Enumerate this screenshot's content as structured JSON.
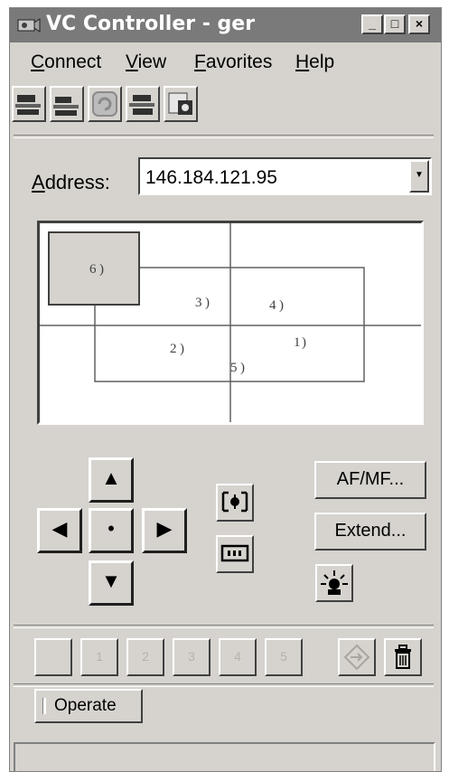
{
  "window": {
    "title": "VC Controller - ger"
  },
  "titlebar_buttons": {
    "minimize": "_",
    "maximize": "□",
    "close": "×"
  },
  "menu": [
    {
      "label": "Connect",
      "mnemonic": "C",
      "rest": "onnect"
    },
    {
      "label": "View",
      "mnemonic": "V",
      "rest": "iew"
    },
    {
      "label": "Favorites",
      "mnemonic": "F",
      "rest": "avorites"
    },
    {
      "label": "Help",
      "mnemonic": "H",
      "rest": "elp"
    }
  ],
  "address": {
    "label_mnemonic": "A",
    "label_rest": "ddress:",
    "value": "146.184.121.95"
  },
  "presets": [
    "1",
    "2",
    "3",
    "4",
    "5",
    "6"
  ],
  "buttons": {
    "af_mf": "AF/MF...",
    "extend": "Extend...",
    "operate": "Operate"
  },
  "icons": {
    "up": "▲",
    "down": "▼",
    "left": "◀",
    "right": "▶",
    "home": "•",
    "dropdown": "▼"
  },
  "colors": {
    "face": "#d6d3ce",
    "title_bg": "#7a7a7a",
    "map_bg": "#ffffff"
  }
}
